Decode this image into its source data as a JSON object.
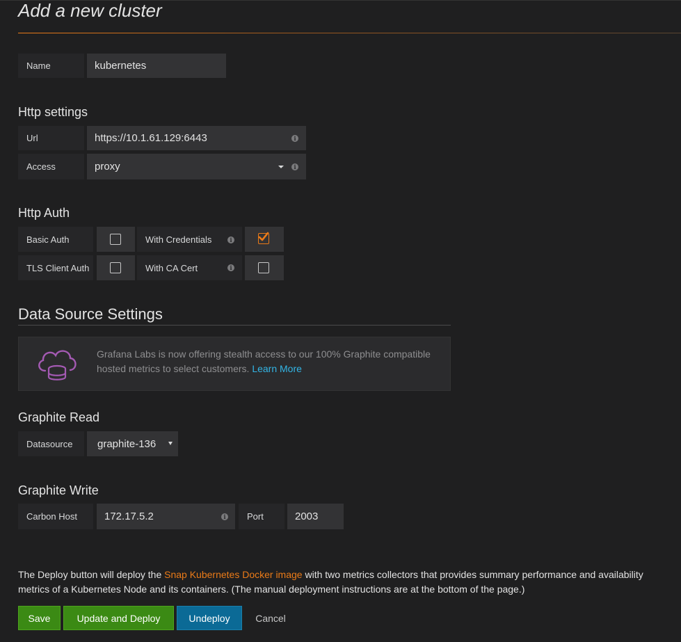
{
  "page": {
    "title": "Add a new cluster"
  },
  "name_field": {
    "label": "Name",
    "value": "kubernetes"
  },
  "http_settings": {
    "heading": "Http settings",
    "url_label": "Url",
    "url_value": "https://10.1.61.129:6443",
    "access_label": "Access",
    "access_value": "proxy"
  },
  "http_auth": {
    "heading": "Http Auth",
    "basic_auth_label": "Basic Auth",
    "basic_auth_checked": false,
    "with_credentials_label": "With Credentials",
    "with_credentials_checked": true,
    "tls_client_auth_label": "TLS Client Auth",
    "tls_client_auth_checked": false,
    "with_ca_cert_label": "With CA Cert",
    "with_ca_cert_checked": false
  },
  "data_source_settings": {
    "heading": "Data Source Settings",
    "promo_text": "Grafana Labs is now offering stealth access to our 100% Graphite compatible hosted metrics to select customers.",
    "promo_link": "Learn More"
  },
  "graphite_read": {
    "heading": "Graphite Read",
    "datasource_label": "Datasource",
    "datasource_value": "graphite-136"
  },
  "graphite_write": {
    "heading": "Graphite Write",
    "carbon_host_label": "Carbon Host",
    "carbon_host_value": "172.17.5.2",
    "port_label": "Port",
    "port_value": "2003"
  },
  "footer": {
    "text_before": "The Deploy button will deploy the",
    "link": "Snap Kubernetes Docker image",
    "text_after": "with two metrics collectors that provides summary performance and availability metrics of a Kubernetes Node and its containers. (The manual deployment instructions are at the bottom of the page.)"
  },
  "buttons": {
    "save": "Save",
    "update_deploy": "Update and Deploy",
    "undeploy": "Undeploy",
    "cancel": "Cancel"
  },
  "icons": {
    "info": "info-icon",
    "caret": "caret-down-icon",
    "cloud": "cloud-database-icon",
    "check": "checkmark-icon"
  },
  "colors": {
    "accent": "#eb7b18",
    "link": "#33b5e5",
    "save_button": "#3b8a14",
    "undeploy_button": "#0b6a96",
    "background": "#1f1f20"
  }
}
